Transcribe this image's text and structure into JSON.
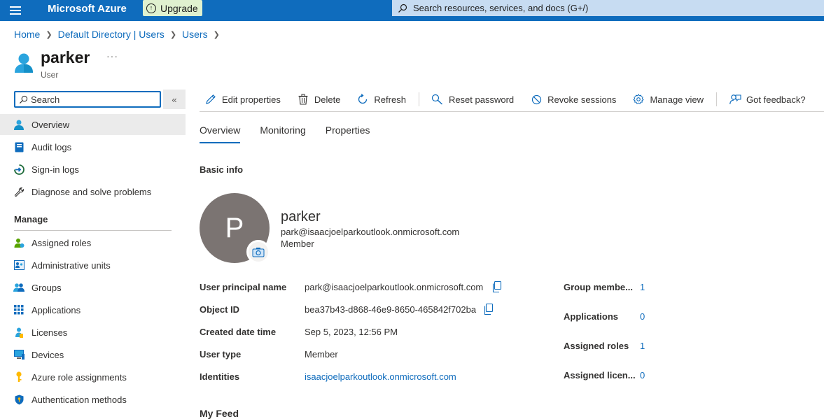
{
  "topbar": {
    "brand": "Microsoft Azure",
    "upgrade_label": "Upgrade",
    "search_placeholder": "Search resources, services, and docs (G+/)"
  },
  "breadcrumb": [
    "Home",
    "Default Directory | Users",
    "Users"
  ],
  "header": {
    "title": "parker",
    "subtitle": "User",
    "more": "···"
  },
  "sidebar": {
    "search_placeholder": "Search",
    "collapse": "«",
    "items": [
      {
        "label": "Overview",
        "icon": "user-icon",
        "active": true
      },
      {
        "label": "Audit logs",
        "icon": "book-icon"
      },
      {
        "label": "Sign-in logs",
        "icon": "sign-in-icon"
      },
      {
        "label": "Diagnose and solve problems",
        "icon": "wrench-icon"
      }
    ],
    "manage_title": "Manage",
    "manage_items": [
      {
        "label": "Assigned roles",
        "icon": "roles-icon"
      },
      {
        "label": "Administrative units",
        "icon": "admin-units-icon"
      },
      {
        "label": "Groups",
        "icon": "groups-icon"
      },
      {
        "label": "Applications",
        "icon": "apps-grid-icon"
      },
      {
        "label": "Licenses",
        "icon": "license-icon"
      },
      {
        "label": "Devices",
        "icon": "device-icon"
      },
      {
        "label": "Azure role assignments",
        "icon": "key-icon"
      },
      {
        "label": "Authentication methods",
        "icon": "shield-icon"
      }
    ]
  },
  "toolbar": {
    "edit": "Edit properties",
    "delete": "Delete",
    "refresh": "Refresh",
    "reset_password": "Reset password",
    "revoke_sessions": "Revoke sessions",
    "manage_view": "Manage view",
    "feedback": "Got feedback?"
  },
  "tabs": [
    "Overview",
    "Monitoring",
    "Properties"
  ],
  "basic_info": {
    "title": "Basic info",
    "avatar_initial": "P",
    "name": "parker",
    "email": "park@isaacjoelparkoutlook.onmicrosoft.com",
    "user_type": "Member"
  },
  "properties": [
    {
      "label": "User principal name",
      "value": "park@isaacjoelparkoutlook.onmicrosoft.com"
    },
    {
      "label": "Object ID",
      "value": "bea37b43-d868-46e9-8650-465842f702ba"
    },
    {
      "label": "Created date time",
      "value": "Sep 5, 2023, 12:56 PM"
    },
    {
      "label": "User type",
      "value": "Member"
    },
    {
      "label": "Identities",
      "value": "isaacjoelparkoutlook.onmicrosoft.com"
    }
  ],
  "stats": [
    {
      "label": "Group membe...",
      "value": "1"
    },
    {
      "label": "Applications",
      "value": "0"
    },
    {
      "label": "Assigned roles",
      "value": "1"
    },
    {
      "label": "Assigned licen...",
      "value": "0"
    }
  ],
  "feed_title": "My Feed",
  "colors": {
    "accent": "#0f6cbd",
    "topbar": "#0f6cbd",
    "upgrade_bg": "#e0f1cf",
    "avatar_bg": "#7b7472"
  }
}
